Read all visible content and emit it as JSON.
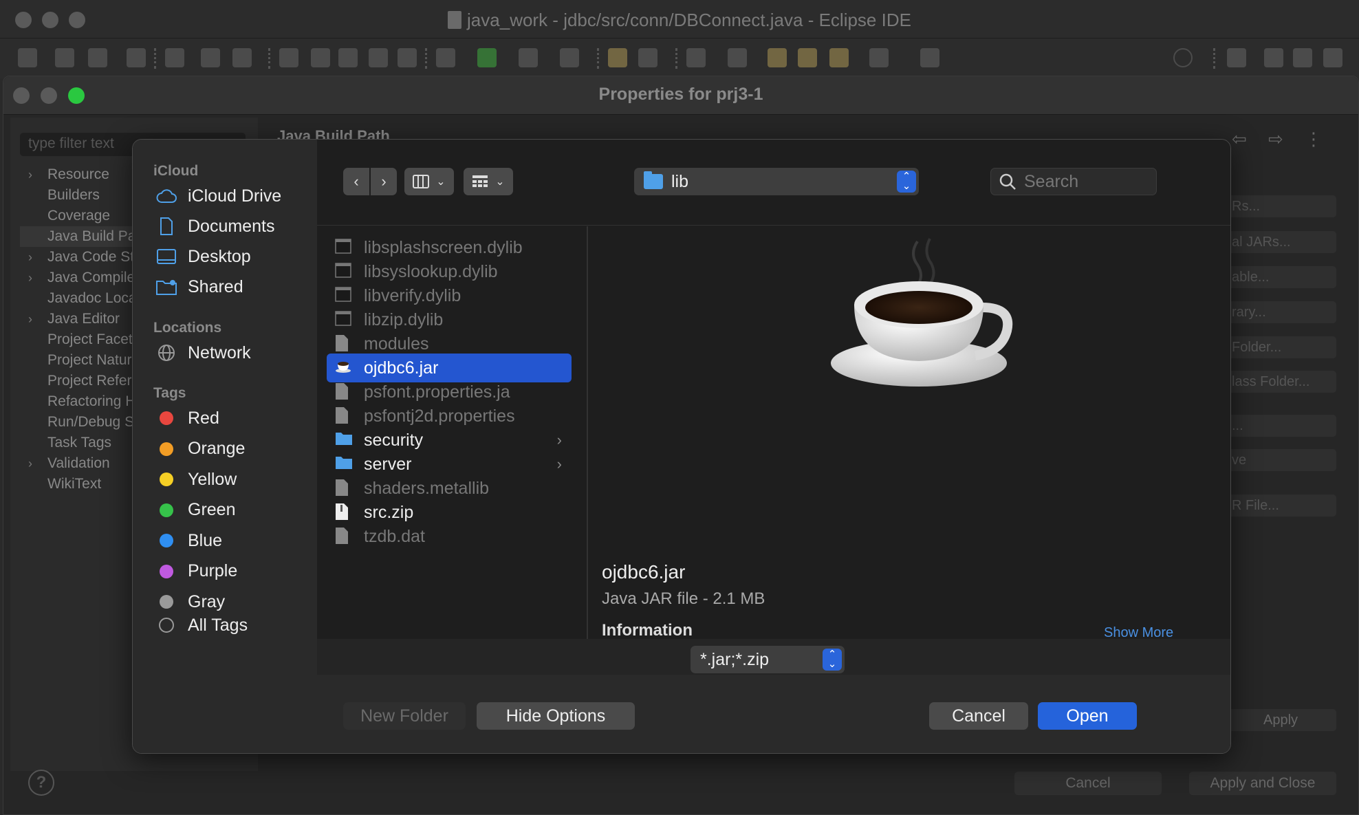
{
  "eclipse": {
    "title": "java_work - jdbc/src/conn/DBConnect.java - Eclipse IDE"
  },
  "properties": {
    "title": "Properties for prj3-1",
    "filter_placeholder": "type filter text",
    "tree": [
      {
        "label": "Resource",
        "expandable": true
      },
      {
        "label": "Builders",
        "expandable": false
      },
      {
        "label": "Coverage",
        "expandable": false
      },
      {
        "label": "Java Build Pa",
        "expandable": false,
        "selected": true
      },
      {
        "label": "Java Code St",
        "expandable": true
      },
      {
        "label": "Java Compile",
        "expandable": true
      },
      {
        "label": "Javadoc Loca",
        "expandable": false
      },
      {
        "label": "Java Editor",
        "expandable": true
      },
      {
        "label": "Project Facet",
        "expandable": false
      },
      {
        "label": "Project Natur",
        "expandable": false
      },
      {
        "label": "Project Refer",
        "expandable": false
      },
      {
        "label": "Refactoring H",
        "expandable": false
      },
      {
        "label": "Run/Debug S",
        "expandable": false
      },
      {
        "label": "Task Tags",
        "expandable": false
      },
      {
        "label": "Validation",
        "expandable": true
      },
      {
        "label": "WikiText",
        "expandable": false
      }
    ],
    "section_title": "Java Build Path",
    "right_buttons": [
      "Rs...",
      "al JARs...",
      "able...",
      "rary...",
      "Folder...",
      "lass Folder...",
      "...",
      "ve",
      "R File..."
    ],
    "apply": "Apply",
    "cancel": "Cancel",
    "apply_and_close": "Apply and Close"
  },
  "panel": {
    "sidebar": {
      "icloud_header": "iCloud",
      "icloud_items": [
        "iCloud Drive",
        "Documents",
        "Desktop",
        "Shared"
      ],
      "locations_header": "Locations",
      "locations_items": [
        "Network"
      ],
      "tags_header": "Tags",
      "tags": [
        {
          "label": "Red",
          "color": "#e8473f"
        },
        {
          "label": "Orange",
          "color": "#f29d25"
        },
        {
          "label": "Yellow",
          "color": "#f5cf25"
        },
        {
          "label": "Green",
          "color": "#36c24a"
        },
        {
          "label": "Blue",
          "color": "#2f8ff2"
        },
        {
          "label": "Purple",
          "color": "#c05ae0"
        },
        {
          "label": "Gray",
          "color": "#9a9a9a"
        }
      ],
      "all_tags": "All Tags"
    },
    "location": "lib",
    "search_placeholder": "Search",
    "files": [
      {
        "name": "libsplashscreen.dylib",
        "kind": "exec",
        "enabled": false
      },
      {
        "name": "libsyslookup.dylib",
        "kind": "exec",
        "enabled": false
      },
      {
        "name": "libverify.dylib",
        "kind": "exec",
        "enabled": false
      },
      {
        "name": "libzip.dylib",
        "kind": "exec",
        "enabled": false
      },
      {
        "name": "modules",
        "kind": "doc",
        "enabled": false
      },
      {
        "name": "ojdbc6.jar",
        "kind": "jar",
        "enabled": true,
        "selected": true
      },
      {
        "name": "psfont.properties.ja",
        "kind": "doc",
        "enabled": false
      },
      {
        "name": "psfontj2d.properties",
        "kind": "doc",
        "enabled": false
      },
      {
        "name": "security",
        "kind": "folder",
        "enabled": true
      },
      {
        "name": "server",
        "kind": "folder",
        "enabled": true
      },
      {
        "name": "shaders.metallib",
        "kind": "doc",
        "enabled": false
      },
      {
        "name": "src.zip",
        "kind": "zip",
        "enabled": true
      },
      {
        "name": "tzdb.dat",
        "kind": "doc",
        "enabled": false
      }
    ],
    "preview": {
      "name": "ojdbc6.jar",
      "kind": "Java JAR file - 2.1 MB",
      "info_label": "Information",
      "show_more": "Show More"
    },
    "filter": "*.jar;*.zip",
    "buttons": {
      "new_folder": "New Folder",
      "hide_options": "Hide Options",
      "cancel": "Cancel",
      "open": "Open"
    }
  }
}
